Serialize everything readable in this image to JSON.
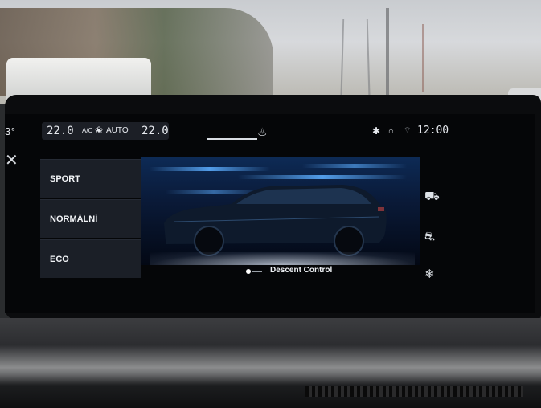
{
  "status_bar": {
    "outside_temp": "3°",
    "temp_left": "22.0",
    "ac_label": "A/C",
    "auto_label": "AUTO",
    "temp_right": "22.0",
    "clock": "12:00",
    "icons": [
      "seat-heater-icon",
      "bluetooth-icon",
      "connected-car-icon",
      "signal-icon"
    ]
  },
  "mode_menu": {
    "close_icon": "close-icon",
    "items": [
      {
        "label": "SPORT"
      },
      {
        "label": "NORMÁLNÍ"
      },
      {
        "label": "ECO"
      }
    ]
  },
  "side_icons": [
    "traction-mode-icon",
    "hill-descent-icon",
    "snow-mode-icon"
  ],
  "descent_control": {
    "label": "Descent Control",
    "enabled": false
  },
  "colors": {
    "menu_bg": "#1b1f27",
    "scene_blue": "#0d2a55",
    "text": "#f2f4f7"
  }
}
